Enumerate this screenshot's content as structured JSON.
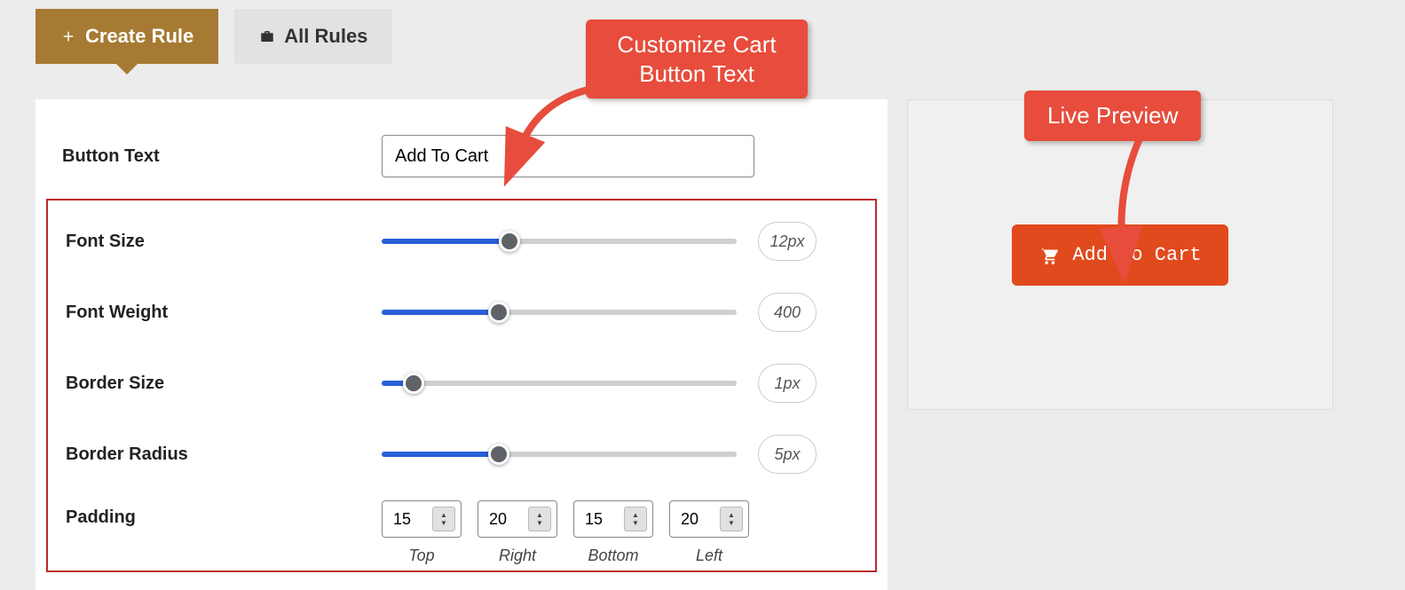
{
  "tabs": {
    "create_label": "Create Rule",
    "all_label": "All Rules"
  },
  "form": {
    "button_text_label": "Button Text",
    "button_text_value": "Add To Cart"
  },
  "sliders": {
    "font_size": {
      "label": "Font Size",
      "value": "12px",
      "percent": 36
    },
    "font_weight": {
      "label": "Font Weight",
      "value": "400",
      "percent": 33
    },
    "border_size": {
      "label": "Border Size",
      "value": "1px",
      "percent": 9
    },
    "border_radius": {
      "label": "Border Radius",
      "value": "5px",
      "percent": 33
    }
  },
  "padding": {
    "label": "Padding",
    "top": {
      "value": "15",
      "label": "Top"
    },
    "right": {
      "value": "20",
      "label": "Right"
    },
    "bottom": {
      "value": "15",
      "label": "Bottom"
    },
    "left": {
      "value": "20",
      "label": "Left"
    }
  },
  "preview": {
    "button_label": "Add To Cart"
  },
  "callouts": {
    "customize": "Customize Cart\nButton Text",
    "live_preview": "Live Preview"
  }
}
